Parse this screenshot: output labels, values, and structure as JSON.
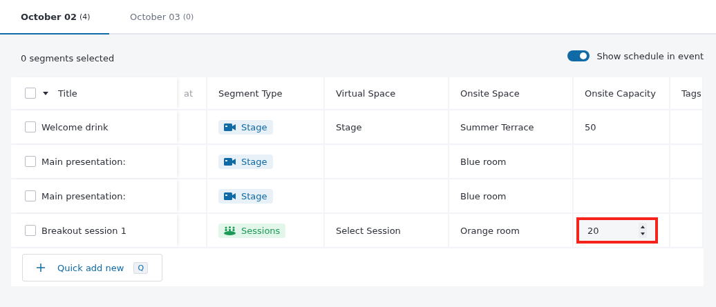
{
  "tabs": [
    {
      "label": "October 02",
      "count": "(4)",
      "selected": true
    },
    {
      "label": "October 03",
      "count": "(0)",
      "selected": false
    }
  ],
  "selection_summary": "0 segments selected",
  "schedule_toggle": {
    "label": "Show schedule in event",
    "on": true
  },
  "table": {
    "select_all_checked": false,
    "columns": [
      "Title",
      "at",
      "Segment Type",
      "Virtual Space",
      "Onsite Space",
      "Onsite Capacity",
      "Tags"
    ],
    "rows": [
      {
        "checked": false,
        "title": "Welcome drink",
        "segment_type": {
          "kind": "stage",
          "label": "Stage"
        },
        "virtual_space": "Stage",
        "onsite_space": "Summer Terrace",
        "onsite_capacity": {
          "value": "50",
          "editing": false,
          "highlighted": false
        }
      },
      {
        "checked": false,
        "title": "Main presentation:",
        "segment_type": {
          "kind": "stage",
          "label": "Stage"
        },
        "onsite_space": "Blue room"
      },
      {
        "checked": false,
        "title": "Main presentation:",
        "segment_type": {
          "kind": "stage",
          "label": "Stage"
        },
        "onsite_space": "Blue room"
      },
      {
        "checked": false,
        "title": "Breakout session 1",
        "segment_type": {
          "kind": "sessions",
          "label": "Sessions"
        },
        "virtual_space": "Select Session",
        "onsite_space": "Orange room",
        "onsite_capacity": {
          "value": "20",
          "editing": true,
          "highlighted": true
        }
      }
    ]
  },
  "quick_add": {
    "label": "Quick add new",
    "shortcut": "Q"
  }
}
